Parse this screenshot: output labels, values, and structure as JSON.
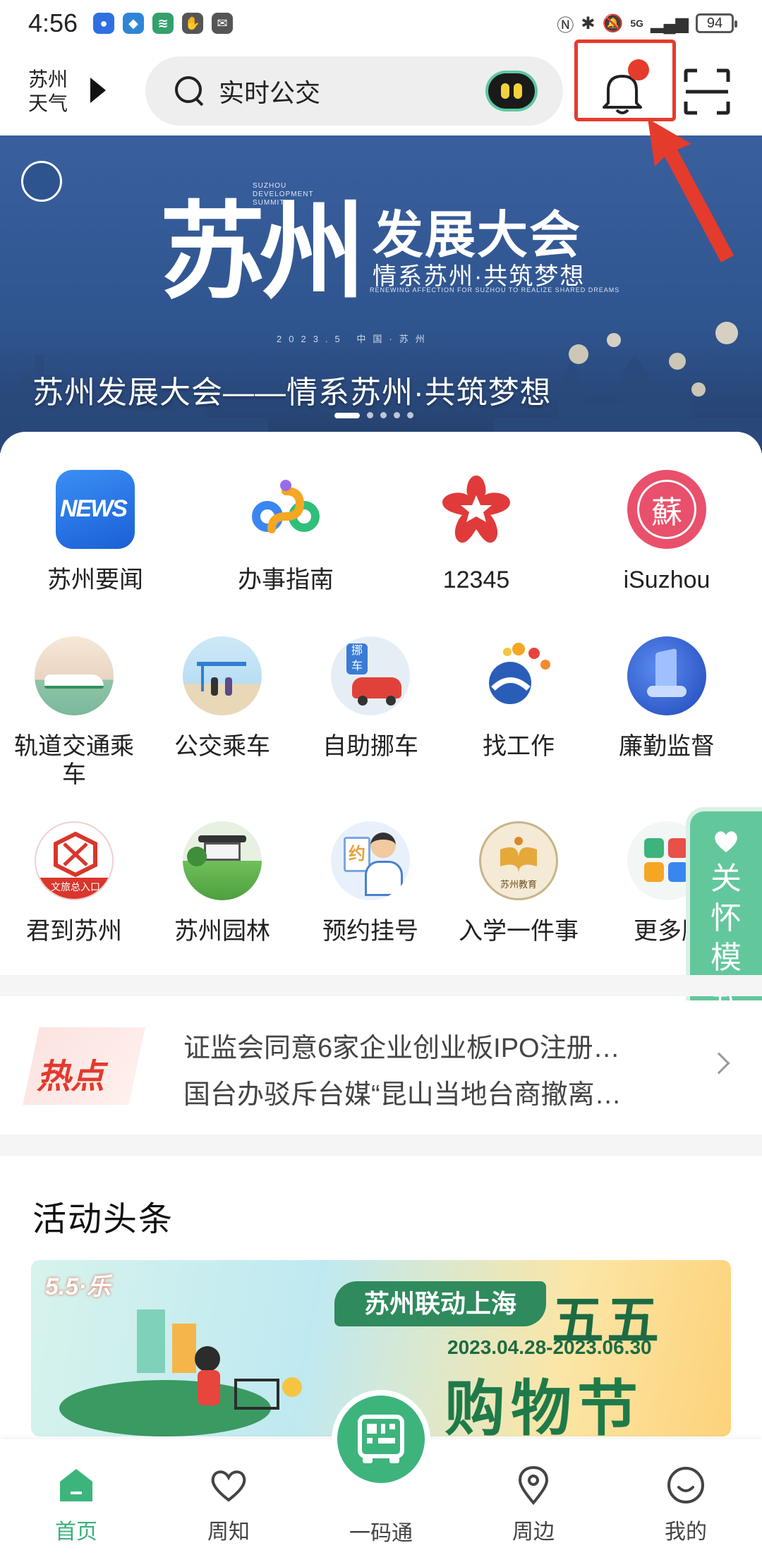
{
  "status_bar": {
    "time": "4:56",
    "network": "5G",
    "battery": "94"
  },
  "header": {
    "weather_label": "苏州\n天气",
    "search_placeholder": "实时公交"
  },
  "banner": {
    "brush_title": "苏州",
    "en_tag": "SUZHOU DEVELOPMENT SUMMIT",
    "title": "发展大会",
    "subtitle": "情系苏州·共筑梦想",
    "subtitle_en": "RENEWING AFFECTION FOR SUZHOU TO REALIZE SHARED DREAMS",
    "date_line": "2023.5 中国·苏州",
    "caption": "苏州发展大会——情系苏州·共筑梦想",
    "active_slide": 1,
    "slide_count": 5
  },
  "apps_row1": [
    {
      "label": "苏州要闻",
      "icon": "news-icon"
    },
    {
      "label": "办事指南",
      "icon": "guide-icon"
    },
    {
      "label": "12345",
      "icon": "hotline-icon"
    },
    {
      "label": "iSuzhou",
      "icon": "isuzhou-icon"
    }
  ],
  "apps_row2": [
    {
      "label": "轨道交通乘车",
      "icon": "metro-icon"
    },
    {
      "label": "公交乘车",
      "icon": "bus-icon"
    },
    {
      "label": "自助挪车",
      "icon": "car-move-icon"
    },
    {
      "label": "找工作",
      "icon": "job-icon"
    },
    {
      "label": "廉勤监督",
      "icon": "supervision-icon"
    }
  ],
  "apps_row3": [
    {
      "label": "君到苏州",
      "icon": "tourism-icon",
      "badge": "文旅总入口"
    },
    {
      "label": "苏州园林",
      "icon": "garden-icon"
    },
    {
      "label": "预约挂号",
      "icon": "appointment-icon",
      "badge": "约"
    },
    {
      "label": "入学一件事",
      "icon": "education-icon",
      "badge": "苏州教育"
    },
    {
      "label": "更多服务",
      "icon": "more-icon"
    }
  ],
  "care_mode": {
    "label": "关怀模式"
  },
  "hot": {
    "logo_text": "热点",
    "lines": [
      "证监会同意6家企业创业板IPO注册…",
      "国台办驳斥台媒“昆山当地台商撤离…"
    ]
  },
  "activity": {
    "section_title": "活动头条",
    "logo_text": "5.5·乐",
    "badge": "苏州联动上海",
    "five": "五五",
    "dates": "2023.04.28-2023.06.30",
    "shop": "购物节"
  },
  "bottom_nav": {
    "home": "首页",
    "notice": "周知",
    "code": "一码通",
    "nearby": "周边",
    "mine": "我的"
  },
  "colors": {
    "accent_green": "#3db47c",
    "alert_red": "#e53b2c",
    "banner_blue": "#3a5f9e"
  }
}
